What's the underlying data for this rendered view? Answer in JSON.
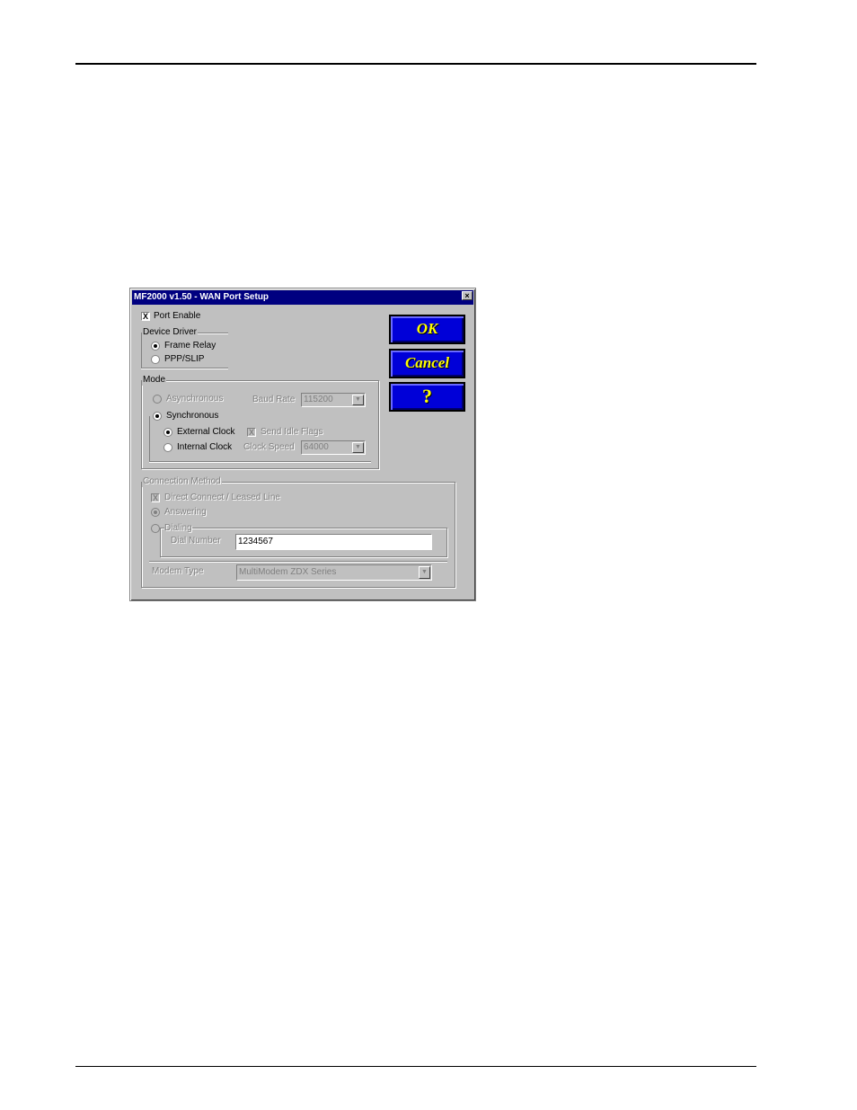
{
  "dialog": {
    "title": "MF2000 v1.50 - WAN Port Setup",
    "close_glyph": "×",
    "port_enable": {
      "label": "Port Enable",
      "checked": true
    },
    "device_driver": {
      "title": "Device Driver",
      "options": [
        {
          "label": "Frame Relay",
          "selected": true
        },
        {
          "label": "PPP/SLIP",
          "selected": false
        }
      ]
    },
    "mode": {
      "title": "Mode",
      "asynchronous": {
        "label": "Asynchronous",
        "selected": false,
        "enabled": false
      },
      "baud_rate": {
        "label": "Baud Rate",
        "value": "115200",
        "enabled": false
      },
      "synchronous": {
        "label": "Synchronous",
        "selected": true
      },
      "external_clock": {
        "label": "External Clock",
        "selected": true
      },
      "send_idle_flags": {
        "label": "Send Idle Flags",
        "checked": true,
        "enabled": false
      },
      "internal_clock": {
        "label": "Internal Clock",
        "selected": false
      },
      "clock_speed": {
        "label": "Clock Speed",
        "value": "64000",
        "enabled": false
      }
    },
    "connection_method": {
      "title": "Connection Method",
      "direct_connect": {
        "label": "Direct Connect / Leased Line",
        "checked": true,
        "enabled": false
      },
      "answering": {
        "label": "Answering",
        "selected": true,
        "enabled": false
      },
      "dialing": {
        "label": "Dialing",
        "selected": false,
        "enabled": false
      },
      "dial_number": {
        "label": "Dial Number",
        "value": "1234567"
      },
      "modem_type": {
        "label": "Modem Type",
        "value": "MultiModem ZDX Series",
        "enabled": false
      }
    },
    "buttons": {
      "ok": "OK",
      "cancel": "Cancel",
      "help": "?"
    },
    "dropdown_glyph": "▼",
    "check_glyph": "X"
  }
}
